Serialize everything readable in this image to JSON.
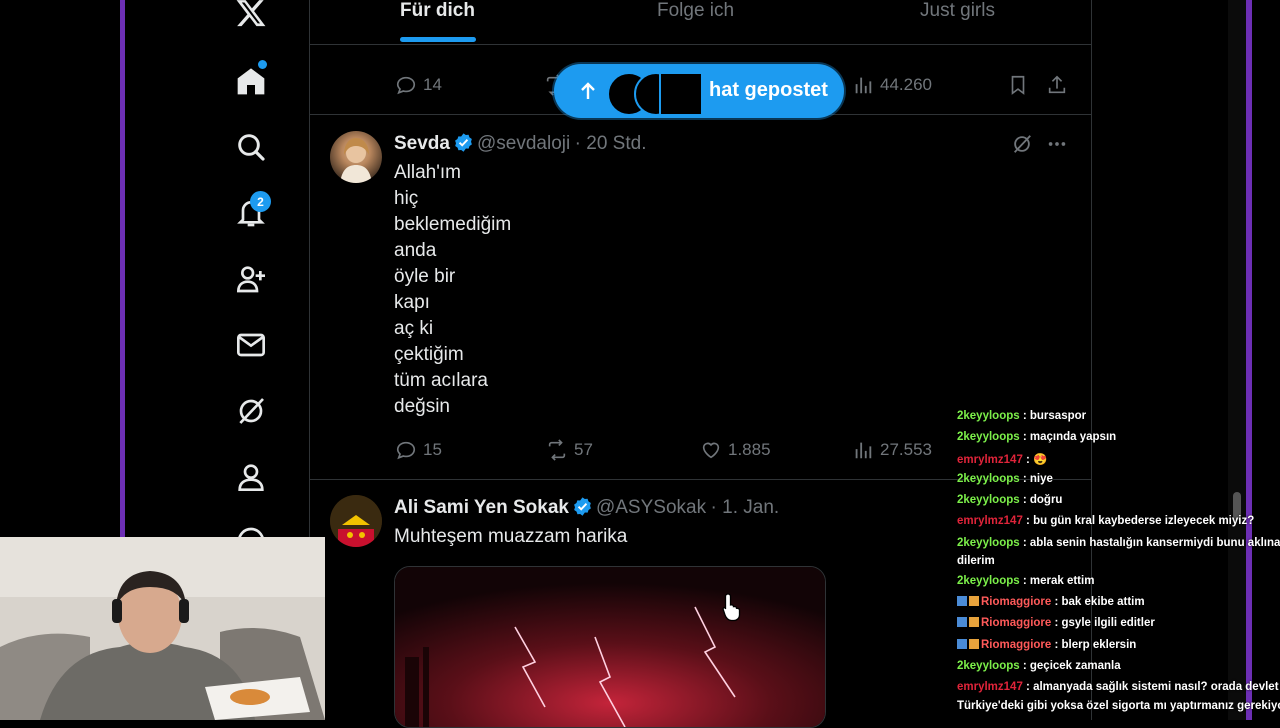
{
  "tabs": [
    "Für dich",
    "Folge ich",
    "Just girls"
  ],
  "sidebar": {
    "notification_count": "2",
    "icons": [
      "x-logo-icon",
      "home-icon",
      "search-icon",
      "notifications-icon",
      "follow-icon",
      "messages-icon",
      "grok-icon",
      "profile-icon"
    ]
  },
  "prev_tweet": {
    "replies": "14",
    "views": "44.260"
  },
  "new_posts_pill": {
    "label": "hat gepostet"
  },
  "tweet1": {
    "name": "Sevda",
    "handle": "@sevdaloji",
    "time": "· 20 Std.",
    "lines": [
      "Allah'ım",
      "hiç",
      "beklemediğim",
      "anda",
      "öyle bir",
      "kapı",
      "aç ki",
      "çektiğim",
      "tüm acılara",
      "değsin"
    ],
    "replies": "15",
    "reposts": "57",
    "likes": "1.885",
    "views": "27.553"
  },
  "tweet2": {
    "name": "Ali Sami Yen Sokak",
    "handle": "@ASYSokak",
    "time": "· 1. Jan.",
    "text": "Muhteşem muazzam harika"
  },
  "chat": [
    {
      "user": "2keyyloops",
      "color": "green",
      "msg": " : bursaspor",
      "badges": false
    },
    {
      "user": "2keyyloops",
      "color": "green",
      "msg": " : maçında yapsın",
      "badges": false
    },
    {
      "user": "emrylmz147",
      "color": "red",
      "msg": " : 😍",
      "badges": false
    },
    {
      "user": "2keyyloops",
      "color": "green",
      "msg": " : niye",
      "badges": false
    },
    {
      "user": "2keyyloops",
      "color": "green",
      "msg": " : doğru",
      "badges": false
    },
    {
      "user": "emrylmz147",
      "color": "red",
      "msg": " : bu gün kral kaybederse izleyecek miyiz?",
      "badges": false
    },
    {
      "user": "2keyyloops",
      "color": "green",
      "msg": " : abla senin hastalığın kansermiydi bunu aklına ge",
      "badges": false
    },
    {
      "user": "",
      "color": "green",
      "msg": "dilerim",
      "badges": false
    },
    {
      "user": "2keyyloops",
      "color": "green",
      "msg": " : merak ettim",
      "badges": false
    },
    {
      "user": "Riomaggiore",
      "color": "pink",
      "msg": " : bak ekibe attim",
      "badges": true
    },
    {
      "user": "Riomaggiore",
      "color": "pink",
      "msg": " : gsyle ilgili editler",
      "badges": true
    },
    {
      "user": "Riomaggiore",
      "color": "pink",
      "msg": " : blerp eklersin",
      "badges": true
    },
    {
      "user": "2keyyloops",
      "color": "green",
      "msg": " : geçicek zamanla",
      "badges": false
    },
    {
      "user": "emrylmz147",
      "color": "red",
      "msg": " : almanyada sağlık sistemi nasıl? orada devlet sig",
      "badges": false
    },
    {
      "user": "",
      "color": "green",
      "msg": "Türkiye'deki gibi yoksa özel sigorta mı yaptırmanız gerekiyor A",
      "badges": false
    }
  ]
}
